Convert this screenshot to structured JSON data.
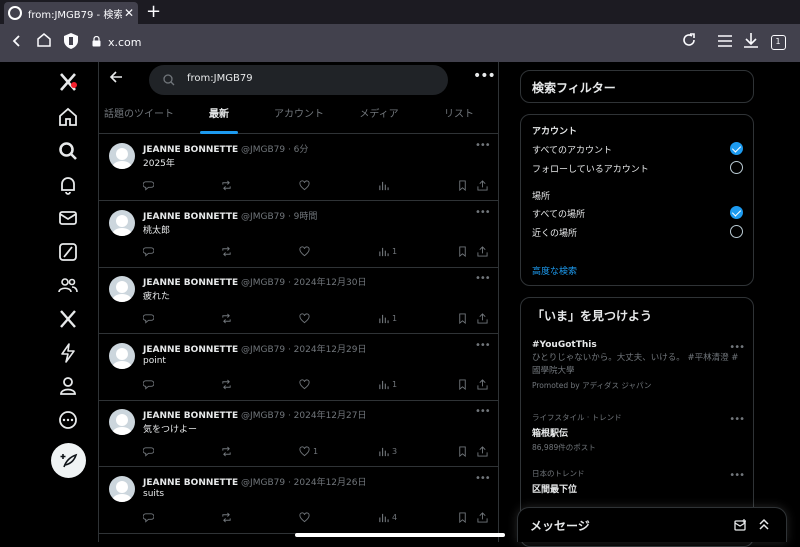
{
  "browser": {
    "tab_title": "from:JMGB79 - 検索 / X",
    "tab_close": "✕",
    "url": "x.com",
    "tabs_count": "1"
  },
  "search": {
    "query": "from:JMGB79"
  },
  "tabs": [
    {
      "label": "話題のツイート"
    },
    {
      "label": "最新"
    },
    {
      "label": "アカウント"
    },
    {
      "label": "メディア"
    },
    {
      "label": "リスト"
    }
  ],
  "tweets": [
    {
      "name": "JEANNE BONNETTE",
      "handle": "@JMGB79",
      "time": "· 6分",
      "text": "2025年",
      "views": ""
    },
    {
      "name": "JEANNE BONNETTE",
      "handle": "@JMGB79",
      "time": "· 9時間",
      "text": "桃太郎",
      "views": "1"
    },
    {
      "name": "JEANNE BONNETTE",
      "handle": "@JMGB79",
      "time": "· 2024年12月30日",
      "text": "疲れた",
      "views": "1"
    },
    {
      "name": "JEANNE BONNETTE",
      "handle": "@JMGB79",
      "time": "· 2024年12月29日",
      "text": "point",
      "views": "1"
    },
    {
      "name": "JEANNE BONNETTE",
      "handle": "@JMGB79",
      "time": "· 2024年12月27日",
      "text": "気をつけよー",
      "likes": "1",
      "views": "3"
    },
    {
      "name": "JEANNE BONNETTE",
      "handle": "@JMGB79",
      "time": "· 2024年12月26日",
      "text": "suits",
      "views": "4"
    }
  ],
  "filter": {
    "title": "検索フィルター",
    "account_heading": "アカウント",
    "all_accounts": "すべてのアカウント",
    "following_accounts": "フォローしているアカウント",
    "place_heading": "場所",
    "all_places": "すべての場所",
    "nearby": "近くの場所",
    "advanced": "高度な検索"
  },
  "trends": {
    "title": "「いま」を見つけよう",
    "items": [
      {
        "title": "#YouGotThis",
        "desc": "ひとりじゃないから。大丈夫、いける。 #平林清澄 #國學院大學",
        "promo": "Promoted by アディダス ジャパン"
      },
      {
        "category": "ライフスタイル · トレンド",
        "title": "箱根駅伝",
        "count": "86,989件のポスト"
      },
      {
        "category": "日本のトレンド",
        "title": "区間最下位"
      }
    ]
  },
  "messages": {
    "title": "メッセージ"
  },
  "colors": {
    "accent": "#1d9bf0",
    "background": "#000000",
    "border": "#2f3336"
  }
}
